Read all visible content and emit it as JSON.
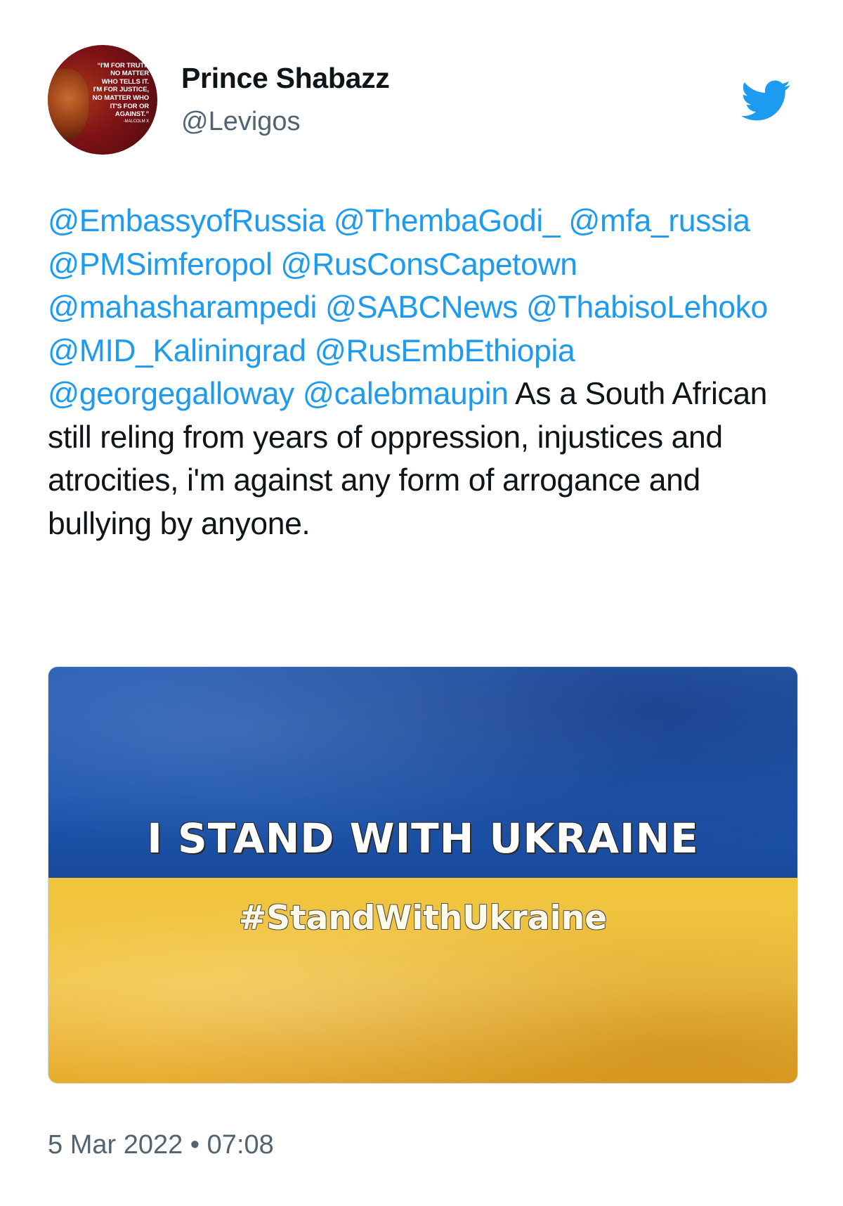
{
  "author": {
    "name": "Prince Shabazz",
    "handle": "@Levigos",
    "avatar_quote": "“I'M FOR TRUTH\nNO MATTER\nWHO TELLS IT.\nI'M FOR JUSTICE,\nNO MATTER WHO\nIT'S FOR OR\nAGAINST.”",
    "avatar_attribution": "-MALCOLM X"
  },
  "tweet": {
    "mentions": [
      "@EmbassyofRussia",
      "@ThembaGodi_",
      "@mfa_russia",
      "@PMSimferopol",
      "@RusConsCapetown",
      "@mahasharampedi",
      "@SABCNews",
      "@ThabisoLehoko",
      "@MID_Kaliningrad",
      "@RusEmbEthiopia",
      "@georgegalloway",
      "@calebmaupin"
    ],
    "text": "As a South African still reling from years of oppression, injustices and atrocities, i'm against any form of arrogance and bullying by anyone."
  },
  "media": {
    "title": "I STAND WITH UKRAINE",
    "hashtag": "#StandWithUkraine"
  },
  "timestamp": {
    "date": "5 Mar 2022",
    "separator": "•",
    "time": "07:08"
  },
  "icons": {
    "brand": "twitter-bird-icon"
  },
  "colors": {
    "mention": "#1d9bf0",
    "brand": "#1d9bf0",
    "text": "#0f1419",
    "muted": "#536471",
    "flag_blue": "#1f57b0",
    "flag_yellow": "#f2c548"
  }
}
